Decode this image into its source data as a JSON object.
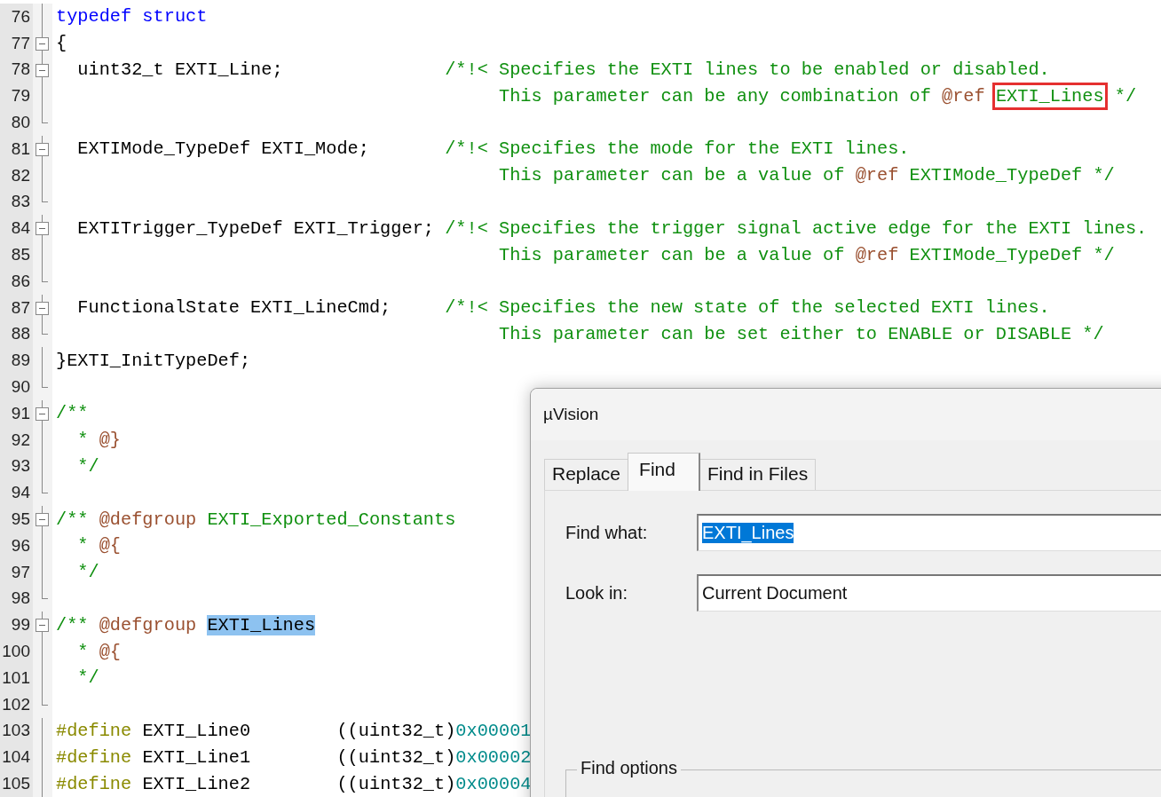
{
  "editor": {
    "lines": [
      {
        "number": "76",
        "kind": "line",
        "segments": [
          {
            "kind": "keyword",
            "text": "typedef struct"
          }
        ]
      },
      {
        "number": "77",
        "kind": "start",
        "segments": [
          {
            "kind": "plain",
            "text": "{"
          }
        ]
      },
      {
        "number": "78",
        "kind": "start",
        "segments": [
          {
            "kind": "plain",
            "text": "  uint32_t EXTI_Line;               "
          },
          {
            "kind": "comment",
            "text": "/*!< Specifies the EXTI lines to be enabled or disabled."
          }
        ]
      },
      {
        "number": "79",
        "kind": "line",
        "segments": [
          {
            "kind": "comment",
            "text": "                                         This parameter can be any combination of "
          },
          {
            "kind": "tag",
            "text": "@ref"
          },
          {
            "kind": "boxed",
            "text": " EXTI_Lines"
          },
          {
            "kind": "comment",
            "text": " */"
          }
        ]
      },
      {
        "number": "80",
        "kind": "end"
      },
      {
        "number": "81",
        "kind": "start",
        "segments": [
          {
            "kind": "plain",
            "text": "  EXTIMode_TypeDef EXTI_Mode;       "
          },
          {
            "kind": "comment",
            "text": "/*!< Specifies the mode for the EXTI lines."
          }
        ]
      },
      {
        "number": "82",
        "kind": "line",
        "segments": [
          {
            "kind": "comment",
            "text": "                                         This parameter can be a value of "
          },
          {
            "kind": "tag",
            "text": "@ref"
          },
          {
            "kind": "comment",
            "text": " EXTIMode_TypeDef */"
          }
        ]
      },
      {
        "number": "83",
        "kind": "end"
      },
      {
        "number": "84",
        "kind": "start",
        "segments": [
          {
            "kind": "plain",
            "text": "  EXTITrigger_TypeDef EXTI_Trigger; "
          },
          {
            "kind": "comment",
            "text": "/*!< Specifies the trigger signal active edge for the EXTI lines."
          }
        ]
      },
      {
        "number": "85",
        "kind": "line",
        "segments": [
          {
            "kind": "comment",
            "text": "                                         This parameter can be a value of "
          },
          {
            "kind": "tag",
            "text": "@ref"
          },
          {
            "kind": "comment",
            "text": " EXTIMode_TypeDef */"
          }
        ]
      },
      {
        "number": "86",
        "kind": "end"
      },
      {
        "number": "87",
        "kind": "start",
        "segments": [
          {
            "kind": "plain",
            "text": "  FunctionalState EXTI_LineCmd;     "
          },
          {
            "kind": "comment",
            "text": "/*!< Specifies the new state of the selected EXTI lines."
          }
        ]
      },
      {
        "number": "88",
        "kind": "end",
        "segments": [
          {
            "kind": "comment",
            "text": "                                         This parameter can be set either to ENABLE or DISABLE */"
          }
        ]
      },
      {
        "number": "89",
        "kind": "line",
        "segments": [
          {
            "kind": "plain",
            "text": "}EXTI_InitTypeDef;"
          }
        ]
      },
      {
        "number": "90",
        "kind": "end"
      },
      {
        "number": "91",
        "kind": "start",
        "segments": [
          {
            "kind": "comment",
            "text": "/**"
          }
        ]
      },
      {
        "number": "92",
        "kind": "line",
        "segments": [
          {
            "kind": "comment",
            "text": "  * "
          },
          {
            "kind": "tag",
            "text": "@}"
          }
        ]
      },
      {
        "number": "93",
        "kind": "line",
        "segments": [
          {
            "kind": "comment",
            "text": "  */"
          }
        ]
      },
      {
        "number": "94",
        "kind": "end"
      },
      {
        "number": "95",
        "kind": "start",
        "segments": [
          {
            "kind": "comment",
            "text": "/** "
          },
          {
            "kind": "tag",
            "text": "@defgroup"
          },
          {
            "kind": "comment",
            "text": " EXTI_Exported_Constants"
          }
        ]
      },
      {
        "number": "96",
        "kind": "line",
        "segments": [
          {
            "kind": "comment",
            "text": "  * "
          },
          {
            "kind": "tag",
            "text": "@{"
          }
        ]
      },
      {
        "number": "97",
        "kind": "line",
        "segments": [
          {
            "kind": "comment",
            "text": "  */"
          }
        ]
      },
      {
        "number": "98",
        "kind": "end"
      },
      {
        "number": "99",
        "kind": "start",
        "segments": [
          {
            "kind": "comment",
            "text": "/** "
          },
          {
            "kind": "tag",
            "text": "@defgroup"
          },
          {
            "kind": "highlight",
            "text": " EXTI_Lines"
          }
        ]
      },
      {
        "number": "100",
        "kind": "line",
        "segments": [
          {
            "kind": "comment",
            "text": "  * "
          },
          {
            "kind": "tag",
            "text": "@{"
          }
        ]
      },
      {
        "number": "101",
        "kind": "line",
        "segments": [
          {
            "kind": "comment",
            "text": "  */"
          }
        ]
      },
      {
        "number": "102",
        "kind": "end"
      },
      {
        "number": "103",
        "kind": "line",
        "segments": [
          {
            "kind": "preproc",
            "text": "#define"
          },
          {
            "kind": "plain",
            "text": " EXTI_Line0        ((uint32_t)"
          },
          {
            "kind": "number",
            "text": "0x00001"
          }
        ]
      },
      {
        "number": "104",
        "kind": "line",
        "segments": [
          {
            "kind": "preproc",
            "text": "#define"
          },
          {
            "kind": "plain",
            "text": " EXTI_Line1        ((uint32_t)"
          },
          {
            "kind": "number",
            "text": "0x00002"
          }
        ]
      },
      {
        "number": "105",
        "kind": "line",
        "segments": [
          {
            "kind": "preproc",
            "text": "#define"
          },
          {
            "kind": "plain",
            "text": " EXTI_Line2        ((uint32_t)"
          },
          {
            "kind": "number",
            "text": "0x00004"
          }
        ]
      }
    ]
  },
  "dialog": {
    "title": "µVision",
    "tabs": [
      {
        "label": "Replace",
        "selected": false
      },
      {
        "label": "Find",
        "selected": true
      },
      {
        "label": "Find in Files",
        "selected": false
      }
    ],
    "fields": [
      {
        "label": "Find what:",
        "value": "EXTI_Lines",
        "text_selected": true
      },
      {
        "label": "Look in:",
        "value": "Current Document",
        "text_selected": false
      }
    ],
    "group": "Find options"
  }
}
